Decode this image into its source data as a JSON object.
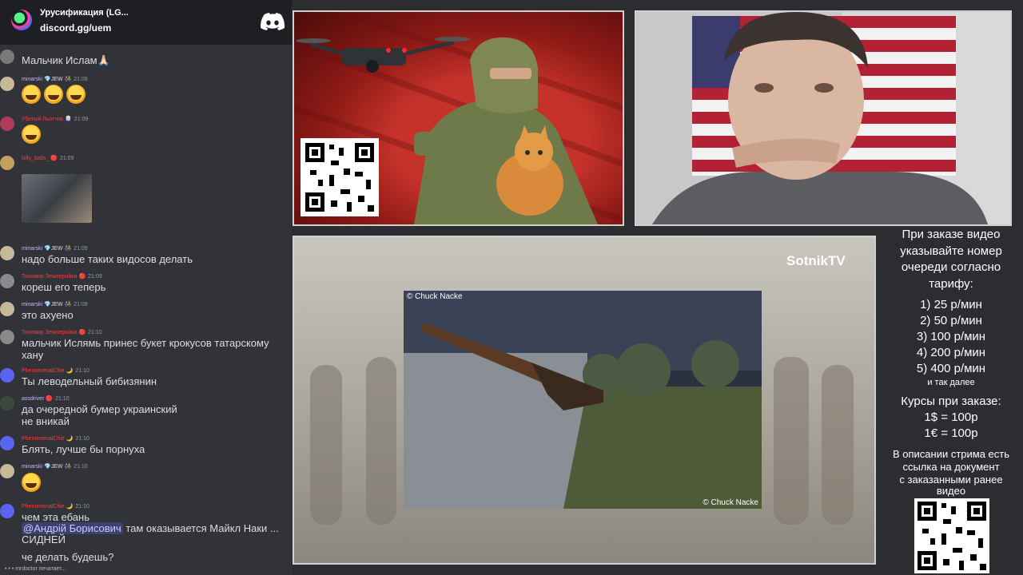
{
  "server": {
    "name": "Урусификация (LG...",
    "link": "discord.gg/uem"
  },
  "messages": [
    {
      "text": "Мальчик Ислам🙏🏻"
    },
    {
      "user": "minarski",
      "badges": "💎JEW 👫",
      "time": "21:09",
      "emojis": 3
    },
    {
      "user": "Убитый Льотчик",
      "badges": "👩🏻‍🦳",
      "time": "21:09",
      "emojis": 1
    },
    {
      "user": "billy_balls_",
      "badges": "🔴",
      "time": "21:09",
      "image": true
    },
    {
      "user": "minarski",
      "badges": "💎JEW 👫",
      "time": "21:09",
      "text": "надо больше таких видосов делать"
    },
    {
      "user": "Тихомир Землеройка",
      "badges": "🔴",
      "time": "21:09",
      "text": "кореш его теперь"
    },
    {
      "user": "minarski",
      "badges": "💎JEW 👫",
      "time": "21:09",
      "text": "это ахуено"
    },
    {
      "user": "Тихомир Землеройка",
      "badges": "🔴",
      "time": "21:10",
      "text": "мальчик Ислямь принес букет крокусов татарскому хану"
    },
    {
      "user": "PhenomenalChie",
      "badges": "🌙",
      "time": "21:10",
      "text": "Ты леводельный бибизянин"
    },
    {
      "user": "assdriver",
      "badges": "🔴",
      "time": "21:10",
      "text": "да очередной бумер украинский\nне вникай"
    },
    {
      "user": "PhenomenalChie",
      "badges": "🌙",
      "time": "21:10",
      "text": "Блять, лучше бы порнуха"
    },
    {
      "user": "minarski",
      "badges": "💎JEW 👫",
      "time": "21:10",
      "emojis": 1
    },
    {
      "user": "PhenomenalChie",
      "badges": "🌙",
      "time": "21:10",
      "text": "чем эта ебань",
      "mention": "@Андрій Борисович",
      "after": "там оказывается Майкл Наки ...",
      "line3": "СИДНЕЙ"
    },
    {
      "text": "че делать будешь?"
    }
  ],
  "typing": "mrdoctor печатает...",
  "main_video": {
    "watermark": "SotnikTV",
    "credit_top": "© Chuck Nacke",
    "credit_bottom": "© Chuck Nacke"
  },
  "info": {
    "title_lines": [
      "При заказе видео",
      "указывайте номер",
      "очереди согласно",
      "тарифу:"
    ],
    "tariffs": [
      "1) 25 р/мин",
      "2) 50 р/мин",
      "3) 100 р/мин",
      "4) 200 р/мин",
      "5) 400 р/мин"
    ],
    "and_more": "и так далее",
    "rates_title": "Курсы при заказе:",
    "rates": [
      "1$ = 100р",
      "1€ = 100р"
    ],
    "desc_lines": [
      "В описании стрима есть",
      "ссылка на документ",
      "с заказанными ранее",
      "видео"
    ]
  },
  "colors": {
    "chat_bg": "#313338",
    "header_bg": "#1e1f22",
    "username": "#c9b3ff",
    "red_name": "#f23f43"
  }
}
